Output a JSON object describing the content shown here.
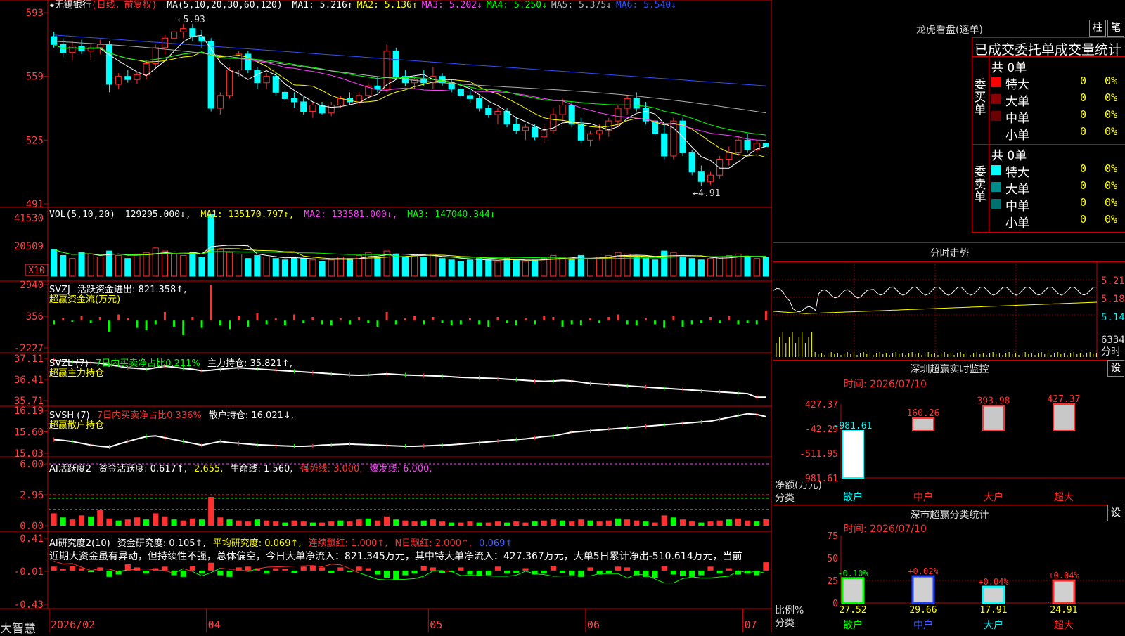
{
  "stock": {
    "name": "★无锡银行",
    "mode": "(日线，前复权)",
    "high_label": "5.93",
    "low_label": "4.91"
  },
  "colors": {
    "up": "#ff3030",
    "down": "#00ffff",
    "ma1": "#ffffff",
    "ma2": "#ffff00",
    "ma3": "#ff40ff",
    "ma4": "#00ff00",
    "ma5": "#b0b0b0",
    "ma6": "#3050ff"
  },
  "main": {
    "ma_title": "MA(5,10,20,30,60,120)",
    "ma_values": [
      {
        "label": "MA1:",
        "value": "5.216",
        "arrow": "↑"
      },
      {
        "label": "MA2:",
        "value": "5.136",
        "arrow": "↑"
      },
      {
        "label": "MA3:",
        "value": "5.202",
        "arrow": "↓"
      },
      {
        "label": "MA4:",
        "value": "5.250",
        "arrow": "↓"
      },
      {
        "label": "MA5:",
        "value": "5.375",
        "arrow": "↓"
      },
      {
        "label": "MA6:",
        "value": "5.540",
        "arrow": "↓"
      }
    ],
    "y_ticks": [
      "593",
      "559",
      "525",
      "491"
    ]
  },
  "vol": {
    "title": "VOL(5,10,20)",
    "value": "129295.000↓,",
    "ma1": "MA1: 135170.797↑,",
    "ma2": "MA2: 133581.000↓,",
    "ma3": "MA3: 147040.344↓",
    "y_ticks": [
      "41530",
      "20509"
    ],
    "unit": "X10"
  },
  "svzj": {
    "title": "SVZJ",
    "line1": "活跃资金进出: 821.358↑,",
    "line2": "超赢资金流(万元)",
    "y_ticks": [
      "2940",
      "356",
      "-2227"
    ]
  },
  "svzl": {
    "title": "SVZL (7)",
    "ratio": "7日内买卖净占比0.211%",
    "hold": "主力持仓: 35.821↑,",
    "line2": "超赢主力持仓",
    "y_ticks": [
      "37.11",
      "36.41",
      "35.71"
    ]
  },
  "svsh": {
    "title": "SVSH (7)",
    "ratio": "7日内买卖净占比0.336%",
    "hold": "散户持仓: 16.021↓,",
    "line2": "超赢散户持仓",
    "y_ticks": [
      "16.19",
      "15.60",
      "15.03"
    ]
  },
  "ai1": {
    "title": "AI活跃度2",
    "v1": "资金活跃度: 0.617↑,",
    "v2": "2.655,",
    "v3": "生命线: 1.560,",
    "v4": "强势线: 3.000,",
    "v5": "爆发线: 6.000,",
    "y_ticks": [
      "6.00",
      "2.96",
      "0.00"
    ]
  },
  "ai2": {
    "title": "AI研究度2(10)",
    "v1": "资金研究度: 0.105↑,",
    "v2": "平均研究度: 0.069↑,",
    "v3": "连续飘红: 1.000↑,",
    "v4": "N日飘红: 2.000↑,",
    "v5": "0.069↑",
    "text": "近期大资金虽有异动，但持续性不强，总体偏空，今日大单净流入：821.345万元，其中特大单净流入：427.367万元，大单5日累计净出-510.614万元，当前",
    "y_ticks": [
      "0.41",
      "-0.01",
      "-0.43"
    ]
  },
  "bottom": {
    "brand": "大智慧",
    "dates": [
      "2026/02",
      "04",
      "05",
      "06",
      "07"
    ]
  },
  "longhu": {
    "title": "龙虎看盘(逐单)",
    "btn1": "柱",
    "btn2": "笔",
    "header": "已成交委托单成交量统计",
    "buy_label": "委买单",
    "sell_label": "委卖单",
    "buy_total": "共 0单",
    "sell_total": "共 0单",
    "buy_rows": [
      {
        "name": "特大",
        "count": "0",
        "pct": "0%",
        "color": "#ff0000"
      },
      {
        "name": "大单",
        "count": "0",
        "pct": "0%",
        "color": "#8b0000"
      },
      {
        "name": "中单",
        "count": "0",
        "pct": "0%",
        "color": "#6b0000"
      },
      {
        "name": "小单",
        "count": "0",
        "pct": "0%",
        "color": "#000000"
      }
    ],
    "sell_rows": [
      {
        "name": "特大",
        "count": "0",
        "pct": "0%",
        "color": "#00ffff"
      },
      {
        "name": "大单",
        "count": "0",
        "pct": "0%",
        "color": "#008b8b"
      },
      {
        "name": "中单",
        "count": "0",
        "pct": "0%",
        "color": "#007070"
      },
      {
        "name": "小单",
        "count": "0",
        "pct": "0%",
        "color": "#000000"
      }
    ]
  },
  "intraday": {
    "title": "分时走势",
    "y_ticks": [
      "5.21",
      "5.18",
      "5.14"
    ],
    "vol_label": "6334",
    "vol_unit": "分时"
  },
  "monitor": {
    "title": "深圳超赢实时监控",
    "btn": "设",
    "time_label": "时间: 2026/07/10",
    "y_ticks": [
      "427.37",
      "-42.29",
      "-511.95",
      "-981.61"
    ],
    "unit_label": "净额(万元)",
    "cat_label": "分类"
  },
  "classify": {
    "title": "深市超赢分类统计",
    "btn": "设",
    "time_label": "时间: 2026/07/10",
    "y_ticks": [
      "75",
      "50",
      "25",
      "0"
    ],
    "unit_label": "比例%",
    "cat_label": "分类"
  },
  "chart_data": [
    {
      "type": "candlestick",
      "title": "无锡银行 日线",
      "ylim": [
        4.8,
        6.0
      ],
      "ohlc": [
        [
          5.85,
          5.88,
          5.78,
          5.8
        ],
        [
          5.8,
          5.84,
          5.72,
          5.75
        ],
        [
          5.75,
          5.82,
          5.7,
          5.79
        ],
        [
          5.79,
          5.83,
          5.74,
          5.76
        ],
        [
          5.76,
          5.8,
          5.7,
          5.78
        ],
        [
          5.78,
          5.83,
          5.74,
          5.8
        ],
        [
          5.8,
          5.82,
          5.5,
          5.55
        ],
        [
          5.55,
          5.62,
          5.52,
          5.6
        ],
        [
          5.6,
          5.64,
          5.56,
          5.58
        ],
        [
          5.58,
          5.63,
          5.55,
          5.61
        ],
        [
          5.61,
          5.7,
          5.58,
          5.68
        ],
        [
          5.68,
          5.8,
          5.65,
          5.78
        ],
        [
          5.78,
          5.86,
          5.74,
          5.84
        ],
        [
          5.84,
          5.9,
          5.8,
          5.88
        ],
        [
          5.88,
          5.93,
          5.84,
          5.9
        ],
        [
          5.9,
          5.93,
          5.82,
          5.85
        ],
        [
          5.85,
          5.89,
          5.78,
          5.82
        ],
        [
          5.82,
          5.84,
          5.38,
          5.4
        ],
        [
          5.4,
          5.5,
          5.36,
          5.48
        ],
        [
          5.48,
          5.66,
          5.46,
          5.64
        ],
        [
          5.64,
          5.76,
          5.6,
          5.74
        ],
        [
          5.74,
          5.76,
          5.62,
          5.64
        ],
        [
          5.64,
          5.66,
          5.52,
          5.56
        ],
        [
          5.56,
          5.62,
          5.52,
          5.6
        ],
        [
          5.6,
          5.62,
          5.48,
          5.5
        ],
        [
          5.5,
          5.54,
          5.44,
          5.46
        ],
        [
          5.46,
          5.5,
          5.4,
          5.44
        ],
        [
          5.44,
          5.47,
          5.36,
          5.38
        ],
        [
          5.38,
          5.44,
          5.34,
          5.42
        ],
        [
          5.42,
          5.44,
          5.36,
          5.37
        ],
        [
          5.37,
          5.44,
          5.35,
          5.42
        ],
        [
          5.42,
          5.48,
          5.4,
          5.46
        ],
        [
          5.46,
          5.5,
          5.42,
          5.44
        ],
        [
          5.44,
          5.5,
          5.42,
          5.48
        ],
        [
          5.48,
          5.56,
          5.46,
          5.54
        ],
        [
          5.54,
          5.6,
          5.5,
          5.52
        ],
        [
          5.52,
          5.8,
          5.5,
          5.76
        ],
        [
          5.76,
          5.78,
          5.58,
          5.6
        ],
        [
          5.6,
          5.64,
          5.54,
          5.56
        ],
        [
          5.56,
          5.6,
          5.52,
          5.58
        ],
        [
          5.58,
          5.64,
          5.54,
          5.56
        ],
        [
          5.56,
          5.66,
          5.52,
          5.6
        ],
        [
          5.6,
          5.62,
          5.54,
          5.56
        ],
        [
          5.56,
          5.58,
          5.5,
          5.52
        ],
        [
          5.52,
          5.56,
          5.46,
          5.48
        ],
        [
          5.48,
          5.52,
          5.44,
          5.46
        ],
        [
          5.46,
          5.48,
          5.38,
          5.4
        ],
        [
          5.4,
          5.42,
          5.34,
          5.36
        ],
        [
          5.36,
          5.4,
          5.3,
          5.38
        ],
        [
          5.38,
          5.4,
          5.28,
          5.3
        ],
        [
          5.3,
          5.34,
          5.24,
          5.26
        ],
        [
          5.26,
          5.3,
          5.2,
          5.28
        ],
        [
          5.28,
          5.3,
          5.2,
          5.22
        ],
        [
          5.22,
          5.3,
          5.18,
          5.26
        ],
        [
          5.26,
          5.4,
          5.24,
          5.36
        ],
        [
          5.36,
          5.46,
          5.32,
          5.42
        ],
        [
          5.42,
          5.44,
          5.28,
          5.3
        ],
        [
          5.3,
          5.34,
          5.18,
          5.2
        ],
        [
          5.2,
          5.26,
          5.16,
          5.24
        ],
        [
          5.24,
          5.3,
          5.2,
          5.26
        ],
        [
          5.26,
          5.34,
          5.22,
          5.32
        ],
        [
          5.32,
          5.42,
          5.28,
          5.4
        ],
        [
          5.4,
          5.48,
          5.36,
          5.46
        ],
        [
          5.46,
          5.5,
          5.38,
          5.4
        ],
        [
          5.4,
          5.44,
          5.3,
          5.32
        ],
        [
          5.32,
          5.34,
          5.22,
          5.24
        ],
        [
          5.24,
          5.3,
          5.08,
          5.1
        ],
        [
          5.1,
          5.34,
          5.08,
          5.32
        ],
        [
          5.32,
          5.34,
          5.1,
          5.12
        ],
        [
          5.12,
          5.14,
          4.98,
          5.0
        ],
        [
          5.0,
          5.04,
          4.91,
          4.94
        ],
        [
          4.94,
          5.0,
          4.92,
          4.98
        ],
        [
          4.98,
          5.1,
          4.96,
          5.08
        ],
        [
          5.08,
          5.16,
          5.04,
          5.12
        ],
        [
          5.12,
          5.22,
          5.1,
          5.2
        ],
        [
          5.2,
          5.24,
          5.12,
          5.14
        ],
        [
          5.14,
          5.2,
          5.12,
          5.18
        ],
        [
          5.18,
          5.22,
          5.12,
          5.16
        ]
      ],
      "ma_series": [
        "MA1",
        "MA2",
        "MA3",
        "MA4",
        "MA5",
        "MA6"
      ]
    },
    {
      "type": "bar",
      "title": "VOL",
      "ylim": [
        0,
        45000
      ],
      "values": [
        18000,
        14000,
        12000,
        16000,
        15000,
        13000,
        17000,
        14000,
        12000,
        15000,
        16000,
        19000,
        17000,
        15000,
        14000,
        16000,
        13000,
        41530,
        18000,
        16000,
        15000,
        12000,
        14000,
        13000,
        12000,
        11000,
        13000,
        12000,
        11000,
        10000,
        11000,
        13000,
        12000,
        14000,
        16000,
        13000,
        17000,
        15000,
        13000,
        14000,
        13000,
        15000,
        12000,
        11000,
        10000,
        11000,
        12000,
        11000,
        10000,
        12000,
        11000,
        10000,
        11000,
        12000,
        14000,
        13000,
        12000,
        14000,
        12000,
        13000,
        14000,
        16000,
        15000,
        13000,
        12000,
        11000,
        17000,
        16000,
        13000,
        12000,
        11000,
        12000,
        13000,
        14000,
        15000,
        13000,
        12000,
        12930
      ]
    },
    {
      "type": "bar",
      "title": "超赢资金流(万元)",
      "ylim": [
        -2227,
        2940
      ],
      "values": [
        -300,
        200,
        -100,
        400,
        -200,
        300,
        -900,
        500,
        200,
        -600,
        -800,
        -300,
        700,
        -500,
        -1200,
        300,
        -600,
        2900,
        -400,
        -700,
        400,
        -500,
        600,
        -300,
        200,
        -400,
        500,
        -200,
        300,
        -300,
        -400,
        200,
        -300,
        300,
        -200,
        -500,
        700,
        -300,
        200,
        400,
        -300,
        300,
        -200,
        -400,
        -300,
        200,
        -300,
        -500,
        300,
        -200,
        -400,
        200,
        -300,
        400,
        300,
        -500,
        -300,
        -400,
        200,
        -200,
        300,
        500,
        -300,
        -400,
        200,
        -300,
        -600,
        400,
        -500,
        -300,
        -200,
        300,
        -200,
        400,
        -300,
        -200,
        -300,
        821
      ]
    },
    {
      "type": "line",
      "title": "超赢主力持仓",
      "ylim": [
        35.71,
        37.11
      ],
      "values": [
        37.05,
        37.02,
        37.0,
        36.98,
        36.97,
        36.95,
        36.9,
        36.85,
        36.8,
        36.78,
        36.75,
        36.8,
        36.85,
        36.82,
        36.78,
        36.75,
        36.7,
        36.72,
        36.75,
        36.78,
        36.8,
        36.78,
        36.76,
        36.74,
        36.72,
        36.7,
        36.68,
        36.66,
        36.64,
        36.62,
        36.6,
        36.58,
        36.56,
        36.55,
        36.56,
        36.58,
        36.6,
        36.58,
        36.56,
        36.55,
        36.54,
        36.53,
        36.52,
        36.5,
        36.48,
        36.47,
        36.46,
        36.45,
        36.44,
        36.42,
        36.4,
        36.38,
        36.36,
        36.35,
        36.36,
        36.38,
        36.36,
        36.32,
        36.28,
        36.26,
        36.24,
        36.22,
        36.2,
        36.18,
        36.16,
        36.14,
        36.12,
        36.1,
        36.08,
        36.06,
        36.04,
        36.02,
        36.0,
        35.98,
        35.96,
        35.94,
        35.82,
        35.821
      ]
    },
    {
      "type": "line",
      "title": "超赢散户持仓",
      "ylim": [
        15.03,
        16.19
      ],
      "values": [
        15.4,
        15.38,
        15.35,
        15.3,
        15.25,
        15.22,
        15.2,
        15.28,
        15.35,
        15.42,
        15.48,
        15.5,
        15.45,
        15.4,
        15.35,
        15.3,
        15.25,
        15.3,
        15.35,
        15.32,
        15.3,
        15.28,
        15.26,
        15.25,
        15.24,
        15.23,
        15.22,
        15.22,
        15.23,
        15.25,
        15.26,
        15.27,
        15.28,
        15.27,
        15.26,
        15.25,
        15.24,
        15.23,
        15.22,
        15.22,
        15.23,
        15.24,
        15.25,
        15.26,
        15.28,
        15.3,
        15.32,
        15.34,
        15.36,
        15.38,
        15.4,
        15.42,
        15.45,
        15.48,
        15.5,
        15.55,
        15.6,
        15.62,
        15.64,
        15.66,
        15.68,
        15.7,
        15.72,
        15.74,
        15.76,
        15.78,
        15.8,
        15.82,
        15.84,
        15.86,
        15.88,
        15.9,
        15.95,
        16.0,
        16.05,
        16.1,
        16.08,
        16.021
      ]
    },
    {
      "type": "bar",
      "title": "AI活跃度2",
      "ylim": [
        0,
        6.0
      ],
      "values": [
        1.2,
        0.8,
        0.6,
        1.0,
        0.9,
        1.5,
        0.7,
        0.5,
        0.6,
        0.8,
        0.6,
        1.2,
        0.9,
        0.6,
        0.5,
        0.7,
        0.6,
        2.8,
        0.8,
        0.6,
        0.5,
        0.4,
        0.6,
        0.5,
        0.4,
        0.3,
        0.5,
        0.4,
        0.3,
        0.3,
        0.4,
        0.5,
        0.4,
        0.6,
        0.7,
        0.5,
        0.9,
        0.6,
        0.5,
        0.4,
        0.5,
        0.6,
        0.4,
        0.3,
        0.3,
        0.4,
        0.3,
        0.3,
        0.4,
        0.3,
        0.4,
        0.3,
        0.4,
        0.5,
        0.6,
        0.5,
        0.4,
        0.6,
        0.5,
        0.4,
        0.5,
        0.7,
        0.6,
        0.5,
        0.4,
        0.3,
        1.0,
        0.8,
        0.6,
        0.4,
        0.3,
        0.4,
        0.5,
        0.6,
        0.7,
        0.5,
        0.4,
        0.617
      ]
    },
    {
      "type": "bar",
      "title": "AI研究度2",
      "ylim": [
        -0.43,
        0.41
      ],
      "values": [
        0.05,
        0.02,
        0.06,
        0.03,
        -0.02,
        0.04,
        -0.08,
        -0.05,
        0.08,
        0.04,
        -0.04,
        0.03,
        0.05,
        -0.06,
        -0.08,
        0.06,
        -0.04,
        0.1,
        -0.06,
        -0.08,
        0.04,
        0.05,
        0.03,
        -0.04,
        0.03,
        0.02,
        -0.03,
        0.05,
        0.06,
        0.04,
        -0.03,
        0.04,
        -0.02,
        0.05,
        0.03,
        -0.05,
        -0.09,
        -0.12,
        -0.06,
        -0.04,
        0.06,
        0.04,
        -0.03,
        -0.02,
        0.04,
        -0.05,
        -0.07,
        -0.06,
        0.05,
        -0.04,
        -0.03,
        0.03,
        -0.05,
        -0.04,
        0.06,
        -0.03,
        -0.06,
        -0.08,
        0.04,
        -0.05,
        -0.03,
        0.05,
        0.04,
        -0.06,
        -0.08,
        -0.09,
        0.06,
        -0.05,
        -0.07,
        -0.08,
        -0.06,
        0.05,
        -0.04,
        0.03,
        -0.05,
        -0.04,
        -0.06,
        0.105
      ]
    },
    {
      "type": "bar",
      "title": "深圳超赢实时监控",
      "categories": [
        "散户",
        "中户",
        "大户",
        "超大"
      ],
      "values": [
        -981.61,
        160.26,
        393.98,
        427.37
      ],
      "ylim": [
        -981.61,
        427.37
      ]
    },
    {
      "type": "bar",
      "title": "深市超赢分类统计",
      "categories": [
        "散户",
        "中户",
        "大户",
        "超大"
      ],
      "values": [
        27.52,
        29.66,
        17.91,
        24.91
      ],
      "changes": [
        "-0.10%",
        "+0.02%",
        "+0.04%",
        "+0.04%"
      ],
      "ylim": [
        0,
        75
      ]
    }
  ]
}
